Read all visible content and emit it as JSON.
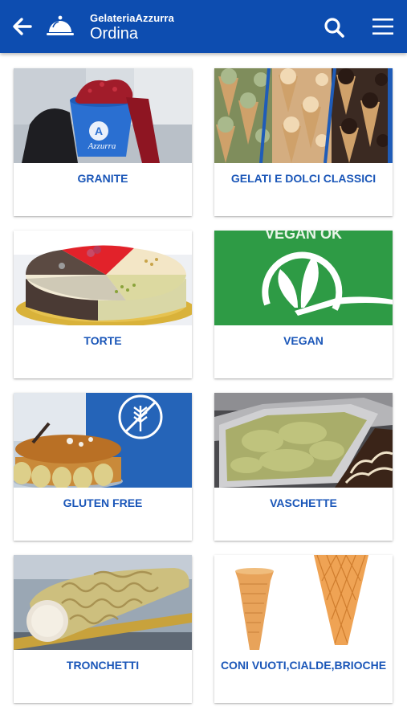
{
  "appbar": {
    "brand": "GelateriaAzzurra",
    "title": "Ordina",
    "back_icon": "arrow-left-icon",
    "logo_icon": "cloche-icon",
    "search_icon": "search-icon",
    "menu_icon": "hamburger-menu-icon",
    "color": "#0d4db0"
  },
  "categories": [
    {
      "label": "GRANITE"
    },
    {
      "label": "GELATI E DOLCI CLASSICI"
    },
    {
      "label": "TORTE"
    },
    {
      "label": "VEGAN"
    },
    {
      "label": "GLUTEN FREE"
    },
    {
      "label": "VASCHETTE"
    },
    {
      "label": "TRONCHETTI"
    },
    {
      "label": "CONI VUOTI,CIALDE,BRIOCHE"
    }
  ],
  "images": {
    "granite_cup_text": "Azzurra",
    "vegan_banner_text": "VEGAN OK"
  },
  "accent_color": "#1a56b8"
}
